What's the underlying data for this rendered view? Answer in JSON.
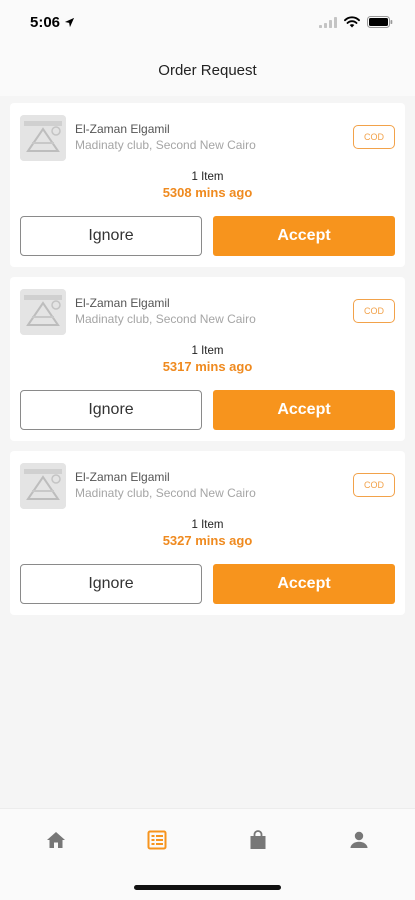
{
  "status_bar": {
    "time": "5:06"
  },
  "header": {
    "title": "Order Request"
  },
  "orders": [
    {
      "store_name": "El-Zaman Elgamil",
      "address": "Madinaty club, Second New Cairo",
      "payment": "COD",
      "item_count": "1 Item",
      "time_ago": "5308 mins ago",
      "ignore_label": "Ignore",
      "accept_label": "Accept"
    },
    {
      "store_name": "El-Zaman Elgamil",
      "address": "Madinaty club, Second New Cairo",
      "payment": "COD",
      "item_count": "1 Item",
      "time_ago": "5317 mins ago",
      "ignore_label": "Ignore",
      "accept_label": "Accept"
    },
    {
      "store_name": "El-Zaman Elgamil",
      "address": "Madinaty club, Second New Cairo",
      "payment": "COD",
      "item_count": "1 Item",
      "time_ago": "5327 mins ago",
      "ignore_label": "Ignore",
      "accept_label": "Accept"
    }
  ],
  "tab_bar": {
    "tabs": [
      {
        "icon": "home-icon",
        "active": false
      },
      {
        "icon": "orders-list-icon",
        "active": true
      },
      {
        "icon": "shopping-bag-icon",
        "active": false
      },
      {
        "icon": "profile-icon",
        "active": false
      }
    ]
  },
  "colors": {
    "accent": "#f7941d",
    "time_text": "#ef8a1f",
    "inactive_icon": "#777777"
  }
}
